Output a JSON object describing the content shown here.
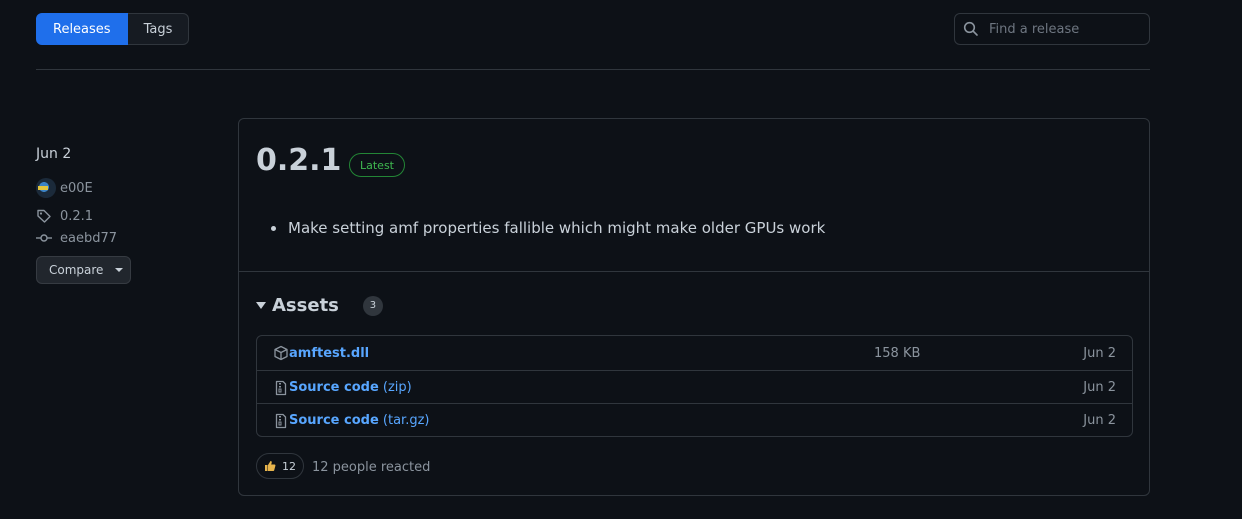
{
  "tabs": {
    "releases": "Releases",
    "tags": "Tags"
  },
  "search": {
    "placeholder": "Find a release"
  },
  "meta": {
    "date": "Jun 2",
    "author": "e00E",
    "tag": "0.2.1",
    "commit": "eaebd77",
    "compare_label": "Compare"
  },
  "release": {
    "title": "0.2.1",
    "badge": "Latest",
    "notes": [
      "Make setting amf properties fallible which might make older GPUs work"
    ]
  },
  "assets": {
    "title": "Assets",
    "count": "3",
    "items": [
      {
        "icon": "package-icon",
        "name": "amftest.dll",
        "ext": "",
        "size": "158 KB",
        "date": "Jun 2"
      },
      {
        "icon": "file-zip-icon",
        "name": "Source code",
        "ext": " (zip)",
        "size": "",
        "date": "Jun 2"
      },
      {
        "icon": "file-zip-icon",
        "name": "Source code",
        "ext": " (tar.gz)",
        "size": "",
        "date": "Jun 2"
      }
    ]
  },
  "reactions": {
    "count": "12",
    "text": "12 people reacted"
  },
  "colors": {
    "accent": "#1f6feb",
    "link": "#58a6ff",
    "badge": "#3fb950",
    "background": "#0d1117"
  }
}
